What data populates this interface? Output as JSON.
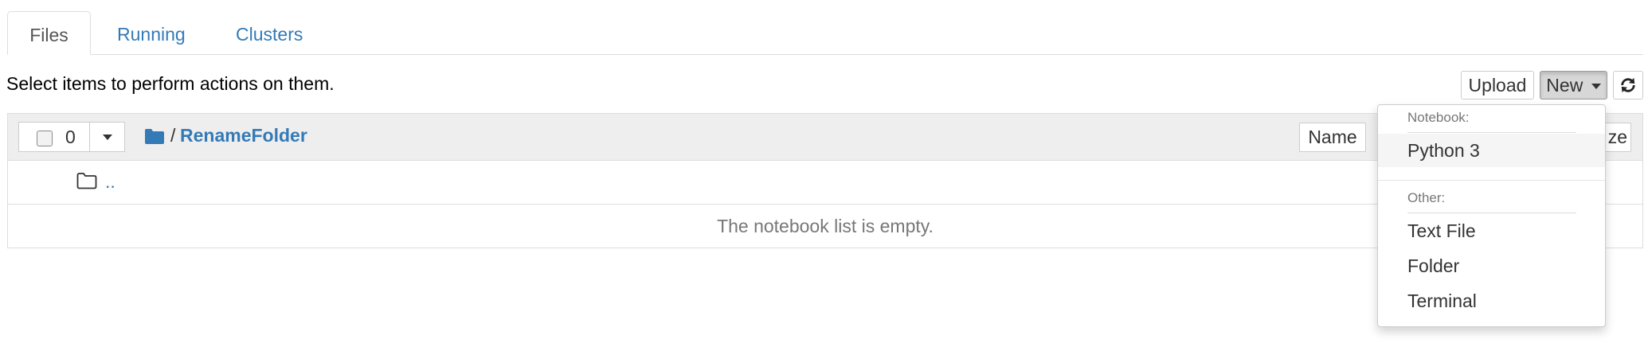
{
  "tabs": [
    {
      "label": "Files",
      "active": true
    },
    {
      "label": "Running",
      "active": false
    },
    {
      "label": "Clusters",
      "active": false
    }
  ],
  "toolbar": {
    "hint": "Select items to perform actions on them.",
    "upload_label": "Upload",
    "new_label": "New",
    "refresh_icon": "refresh-icon"
  },
  "list_header": {
    "selected_count": "0",
    "separator": "/",
    "current_folder": "RenameFolder",
    "sort_name_label": "Name",
    "sort_size_label_partial": "ze"
  },
  "list": {
    "parent_link": "..",
    "empty_message": "The notebook list is empty."
  },
  "new_menu": {
    "notebook_header": "Notebook:",
    "notebook_items": [
      "Python 3"
    ],
    "other_header": "Other:",
    "other_items": [
      "Text File",
      "Folder",
      "Terminal"
    ]
  },
  "colors": {
    "link": "#337ab7",
    "header_bg": "#eeeeee",
    "border": "#dddddd"
  }
}
